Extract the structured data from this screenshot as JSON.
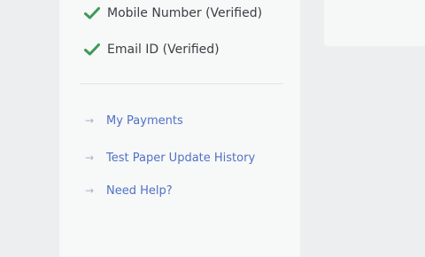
{
  "verification": {
    "items": [
      {
        "label": "Mobile Number (Verified)",
        "icon": "check-icon"
      },
      {
        "label": "Email ID (Verified)",
        "icon": "check-icon"
      }
    ],
    "check_color": "#3f9a55"
  },
  "links": {
    "items": [
      {
        "label": "My Payments",
        "icon": "arrow-right-icon"
      },
      {
        "label": "Test Paper Update History",
        "icon": "arrow-right-icon"
      },
      {
        "label": "Need Help?",
        "icon": "arrow-right-icon"
      }
    ],
    "link_color": "#4f72c6",
    "arrow_glyph": "→"
  }
}
